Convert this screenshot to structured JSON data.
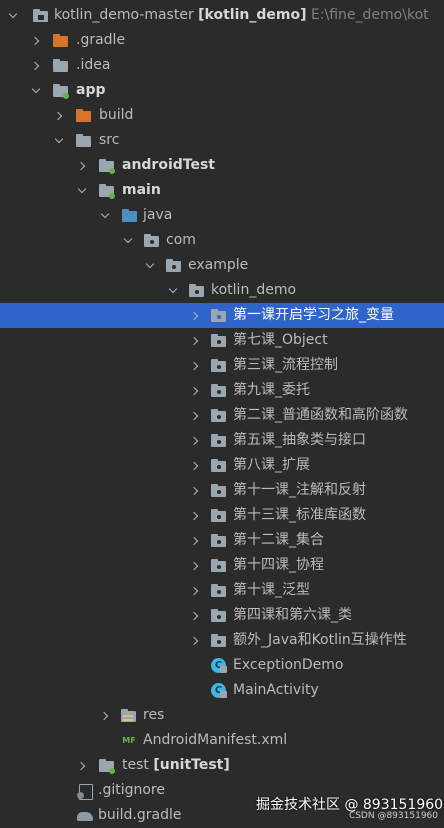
{
  "project": {
    "name": "kotlin_demo-master",
    "module": "[kotlin_demo]",
    "path": "E:\\fine_demo\\kot"
  },
  "rows": [
    {
      "label": "kotlin_demo-master",
      "extra": "[kotlin_demo]",
      "hint": "E:\\fine_demo\\kot",
      "icon": "module-folder-icon"
    },
    {
      "label": ".gradle",
      "icon": "excluded-folder-icon"
    },
    {
      "label": ".idea",
      "icon": "folder-icon"
    },
    {
      "label": "app",
      "icon": "module-folder-icon"
    },
    {
      "label": "build",
      "icon": "excluded-folder-icon"
    },
    {
      "label": "src",
      "icon": "folder-icon"
    },
    {
      "label": "androidTest",
      "icon": "test-folder-icon"
    },
    {
      "label": "main",
      "icon": "source-set-folder-icon"
    },
    {
      "label": "java",
      "icon": "source-root-folder-icon"
    },
    {
      "label": "com",
      "icon": "package-icon"
    },
    {
      "label": "example",
      "icon": "package-icon"
    },
    {
      "label": "kotlin_demo",
      "icon": "package-icon"
    },
    {
      "label": "第一课开启学习之旅_变量",
      "icon": "package-icon"
    },
    {
      "label": "第七课_Object",
      "icon": "package-icon"
    },
    {
      "label": "第三课_流程控制",
      "icon": "package-icon"
    },
    {
      "label": "第九课_委托",
      "icon": "package-icon"
    },
    {
      "label": "第二课_普通函数和高阶函数",
      "icon": "package-icon"
    },
    {
      "label": "第五课_抽象类与接口",
      "icon": "package-icon"
    },
    {
      "label": "第八课_扩展",
      "icon": "package-icon"
    },
    {
      "label": "第十一课_注解和反射",
      "icon": "package-icon"
    },
    {
      "label": "第十三课_标准库函数",
      "icon": "package-icon"
    },
    {
      "label": "第十二课_集合",
      "icon": "package-icon"
    },
    {
      "label": "第十四课_协程",
      "icon": "package-icon"
    },
    {
      "label": "第十课_泛型",
      "icon": "package-icon"
    },
    {
      "label": "第四课和第六课_类",
      "icon": "package-icon"
    },
    {
      "label": "额外_Java和Kotlin互操作性",
      "icon": "package-icon"
    },
    {
      "label": "ExceptionDemo",
      "icon": "kotlin-class-icon"
    },
    {
      "label": "MainActivity",
      "icon": "kotlin-class-icon"
    },
    {
      "label": "res",
      "icon": "resources-folder-icon"
    },
    {
      "label": "AndroidManifest.xml",
      "icon": "manifest-file-icon"
    },
    {
      "label": "test",
      "extra": "[unitTest]",
      "icon": "test-folder-icon"
    },
    {
      "label": ".gitignore",
      "icon": "gitignore-file-icon"
    },
    {
      "label": "build.gradle",
      "icon": "gradle-file-icon"
    }
  ],
  "selected": "第一课开启学习之旅_变量",
  "watermark": {
    "text": "掘金技术社区 @ 893151960",
    "sub": "CSDN @893151960"
  },
  "colors": {
    "background": "#2b2b2b",
    "selection": "#2f65ca",
    "folder": "#9aa7b0",
    "excluded_folder": "#d7742a",
    "source_root": "#4a90c2",
    "accent_dot": "#40b6e0"
  }
}
